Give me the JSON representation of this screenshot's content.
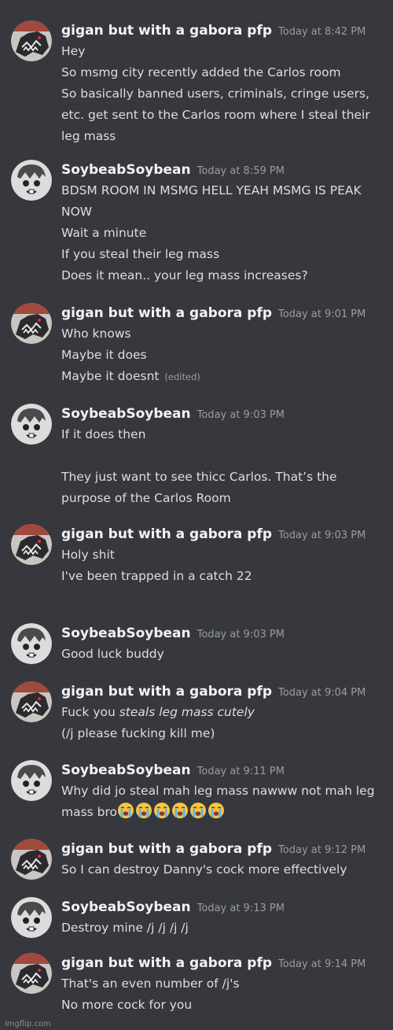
{
  "messages": [
    {
      "id": "m1",
      "author": "gigan but with a gabora pfp",
      "avatar": "gigan-avatar",
      "time": "Today at 8:42 PM",
      "lines": [
        "Hey",
        "So msmg city recently added the Carlos room",
        "So basically banned users, criminals, cringe users, etc. get sent to the Carlos room where I steal their leg mass"
      ]
    },
    {
      "id": "m2",
      "author": "SoybeabSoybean",
      "avatar": "soybean-avatar",
      "time": "Today at 8:59 PM",
      "lines": [
        "BDSM ROOM IN MSMG HELL YEAH MSMG IS PEAK NOW",
        "Wait a minute",
        "If you steal their leg mass",
        "Does it mean.. your leg mass increases?"
      ]
    },
    {
      "id": "m3",
      "author": "gigan but with a gabora pfp",
      "avatar": "gigan-avatar",
      "time": "Today at 9:01 PM",
      "lines": [
        "Who knows",
        "Maybe it does",
        "Maybe it doesnt"
      ],
      "edited_label": "(edited)"
    },
    {
      "id": "m4",
      "author": "SoybeabSoybean",
      "avatar": "soybean-avatar",
      "time": "Today at 9:03 PM",
      "lines": [
        "If it does then",
        "",
        "They just want to see thicc Carlos. That’s the purpose of the Carlos Room"
      ]
    },
    {
      "id": "m5",
      "author": "gigan but with a gabora pfp",
      "avatar": "gigan-avatar",
      "time": "Today at 9:03 PM",
      "lines": [
        "Holy shit",
        "I've been trapped in a catch 22"
      ]
    },
    {
      "id": "m6",
      "author": "SoybeabSoybean",
      "avatar": "soybean-avatar",
      "time": "Today at 9:03 PM",
      "lines": [
        "Good luck buddy"
      ]
    },
    {
      "id": "m7",
      "author": "gigan but with a gabora pfp",
      "avatar": "gigan-avatar",
      "time": "Today at 9:04 PM",
      "line1_prefix": "Fuck you ",
      "line1_italic": "steals leg mass cutely",
      "lines": [
        "(/j please fucking kill me)"
      ]
    },
    {
      "id": "m8",
      "author": "SoybeabSoybean",
      "avatar": "soybean-avatar",
      "time": "Today at 9:11 PM",
      "lines": [
        "Why did jo steal mah leg mass nawww not mah leg mass bro"
      ],
      "emoji": "loudly-crying-face",
      "emoji_count": 6
    },
    {
      "id": "m9",
      "author": "gigan but with a gabora pfp",
      "avatar": "gigan-avatar",
      "time": "Today at 9:12 PM",
      "lines": [
        "So I can destroy Danny's cock more effectively"
      ]
    },
    {
      "id": "m10",
      "author": "SoybeabSoybean",
      "avatar": "soybean-avatar",
      "time": "Today at 9:13 PM",
      "lines": [
        "Destroy mine /j /j /j /j"
      ]
    },
    {
      "id": "m11",
      "author": "gigan but with a gabora pfp",
      "avatar": "gigan-avatar",
      "time": "Today at 9:14 PM",
      "lines": [
        "That's an even number of /j's",
        "No more cock for you"
      ]
    }
  ],
  "footer": "imgflip.com",
  "colors": {
    "background": "#36383e",
    "username": "#f2f3f5",
    "timestamp": "#9a9ca3",
    "text": "#dcdee2"
  }
}
